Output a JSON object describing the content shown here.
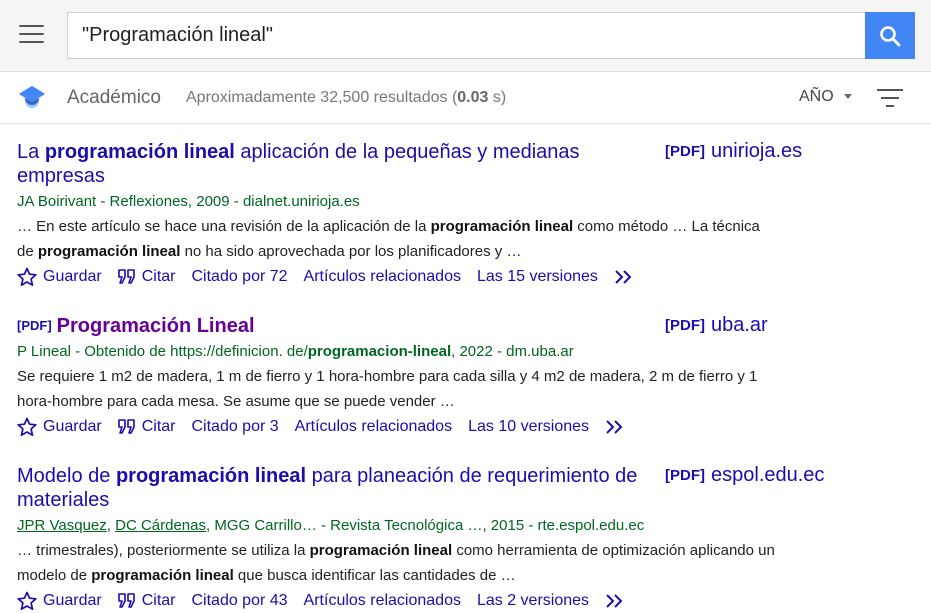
{
  "search": {
    "query": "\"Programación lineal\""
  },
  "header": {
    "brand": "Académico",
    "stats_prefix": "Aproximadamente 32,500 resultados (",
    "stats_time": "0.03",
    "stats_suffix": " s)",
    "year_label": "AÑO"
  },
  "results": [
    {
      "title_parts": [
        "La ",
        "programación lineal",
        " aplicación de la pequeñas y medianas empresas"
      ],
      "side_tag": "[PDF]",
      "side_domain": "unirioja.es",
      "meta": "JA Boirivant - Reflexiones, 2009 - dialnet.unirioja.es",
      "snippet_parts": [
        "… En este artículo se hace una revisión de la aplicación de la ",
        "programación lineal",
        " como método … La técnica de ",
        "programación lineal",
        " no ha sido aprovechada por los planificadores y …"
      ],
      "save": "Guardar",
      "cite": "Citar",
      "cited_by": "Citado por 72",
      "related": "Artículos relacionados",
      "versions": "Las 15 versiones"
    },
    {
      "title_tag": "[PDF]",
      "title": "Programación Lineal",
      "side_tag": "[PDF]",
      "side_domain": "uba.ar",
      "meta_parts": [
        "P Lineal - Obtenido de https://definicion. de/",
        "programacion-lineal",
        ", 2022 - dm.uba.ar"
      ],
      "snippet": "Se requiere 1 m2 de madera, 1 m de fierro y 1 hora-hombre para cada silla y 4 m2 de madera, 2 m de fierro y 1 hora-hombre para cada mesa. Se asume que se puede vender …",
      "save": "Guardar",
      "cite": "Citar",
      "cited_by": "Citado por 3",
      "related": "Artículos relacionados",
      "versions": "Las 10 versiones"
    },
    {
      "title_parts": [
        "Modelo de ",
        "programación lineal",
        " para planeación de requerimiento de materiales"
      ],
      "side_tag": "[PDF]",
      "side_domain": "espol.edu.ec",
      "authors": [
        "JPR Vasquez",
        "DC Cárdenas"
      ],
      "meta_rest": ", MGG Carrillo… - Revista Tecnológica …, 2015 - rte.espol.edu.ec",
      "snippet_parts": [
        "… trimestrales), posteriormente se utiliza la ",
        "programación lineal",
        " como herramienta de optimización aplicando un modelo de ",
        "programación lineal",
        " que busca identificar las cantidades de …"
      ],
      "save": "Guardar",
      "cite": "Citar",
      "cited_by": "Citado por 43",
      "related": "Artículos relacionados",
      "versions": "Las 2 versiones"
    }
  ],
  "colors": {
    "link": "#1a0dab",
    "visited": "#660099",
    "meta": "#006621",
    "search_button": "#4285f4"
  },
  "icons": [
    "menu-icon",
    "search-icon",
    "scholar-logo-icon",
    "filter-icon",
    "star-icon",
    "quote-icon",
    "chevron-double-right-icon"
  ]
}
